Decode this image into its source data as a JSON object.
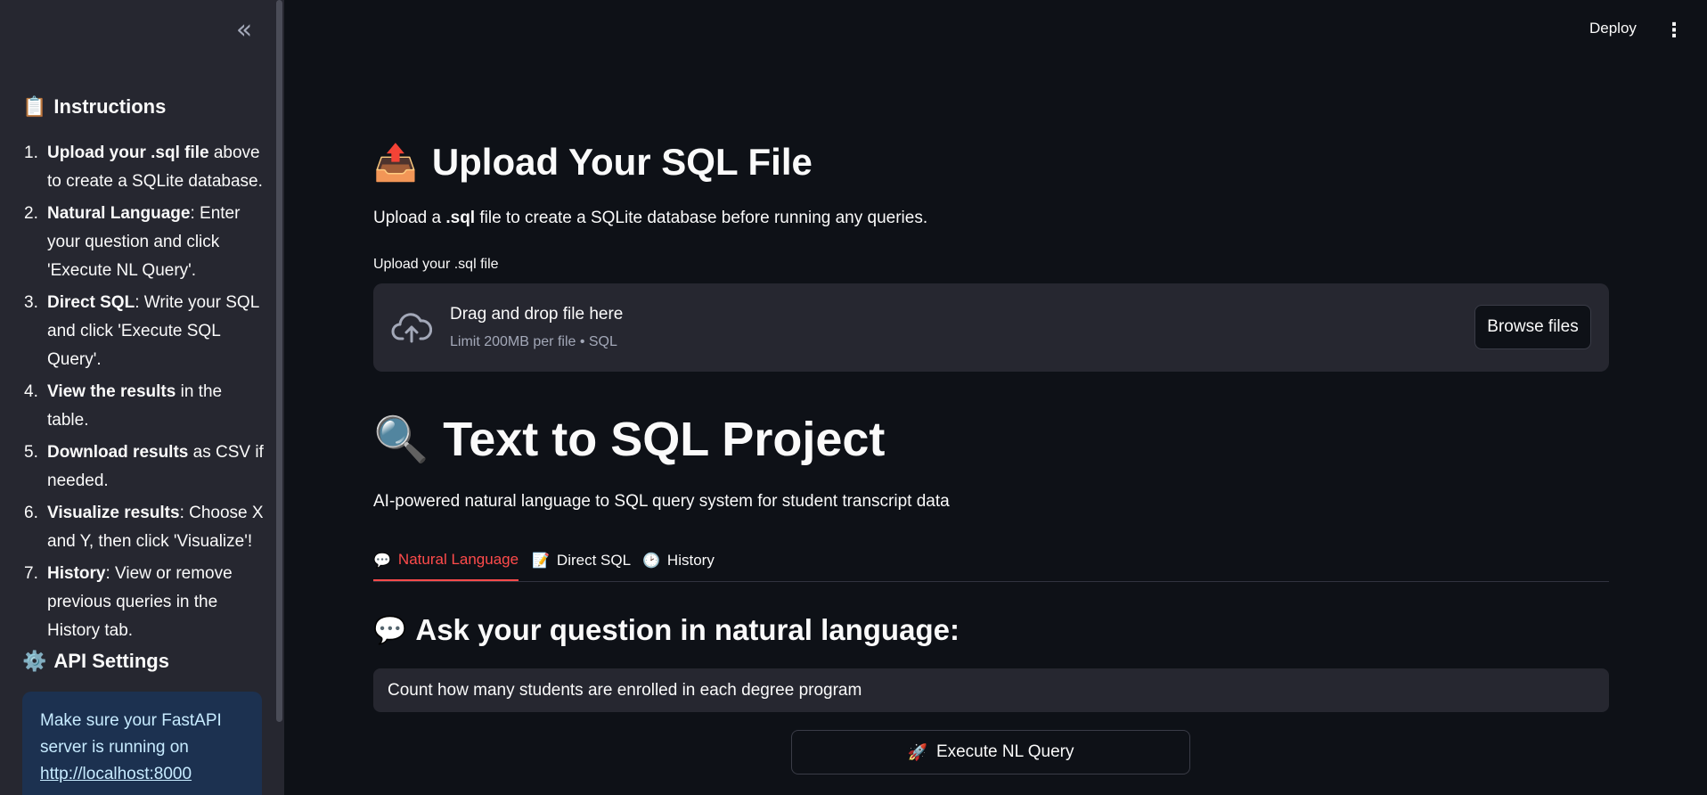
{
  "sidebar": {
    "collapse_icon": "«",
    "instructions_title": "Instructions",
    "instructions_icon": "📋",
    "items": [
      {
        "num": "1.",
        "bold": "Upload your .sql file",
        "rest": " above to create a SQLite database."
      },
      {
        "num": "2.",
        "bold": "Natural Language",
        "rest": ": Enter your question and click 'Execute NL Query'."
      },
      {
        "num": "3.",
        "bold": "Direct SQL",
        "rest": ": Write your SQL and click 'Execute SQL Query'."
      },
      {
        "num": "4.",
        "bold": "View the results",
        "rest": " in the table."
      },
      {
        "num": "5.",
        "bold": "Download results",
        "rest": " as CSV if needed."
      },
      {
        "num": "6.",
        "bold": "Visualize results",
        "rest": ": Choose X and Y, then click 'Visualize'!"
      },
      {
        "num": "7.",
        "bold": "History",
        "rest": ": View or remove previous queries in the History tab."
      }
    ],
    "api_title": "API Settings",
    "api_icon": "⚙️",
    "info_text": "Make sure your FastAPI server is running on",
    "info_link": "http://localhost:8000"
  },
  "topbar": {
    "deploy_label": "Deploy",
    "menu_icon": "⋮"
  },
  "upload": {
    "icon": "📤",
    "title": "Upload Your SQL File",
    "desc_prefix": "Upload a ",
    "desc_bold": ".sql",
    "desc_suffix": " file to create a SQLite database before running any queries.",
    "field_label": "Upload your .sql file",
    "drop_title": "Drag and drop file here",
    "drop_sub": "Limit 200MB per file • SQL",
    "browse_label": "Browse files"
  },
  "project": {
    "icon": "🔍",
    "title": "Text to SQL Project",
    "subtitle": "AI-powered natural language to SQL query system for student transcript data"
  },
  "tabs": [
    {
      "icon": "💬",
      "label": "Natural Language",
      "active": true
    },
    {
      "icon": "📝",
      "label": "Direct SQL",
      "active": false
    },
    {
      "icon": "🕑",
      "label": "History",
      "active": false
    }
  ],
  "nl": {
    "icon": "💬",
    "heading": "Ask your question in natural language:",
    "query_value": "Count how many students are enrolled in each degree program",
    "execute_icon": "🚀",
    "execute_label": "Execute NL Query"
  },
  "colors": {
    "accent": "#ff4b4b",
    "background": "#0e1117",
    "sidebar": "#262730",
    "info_bg": "#1c3150",
    "info_text": "#c7ebff"
  }
}
